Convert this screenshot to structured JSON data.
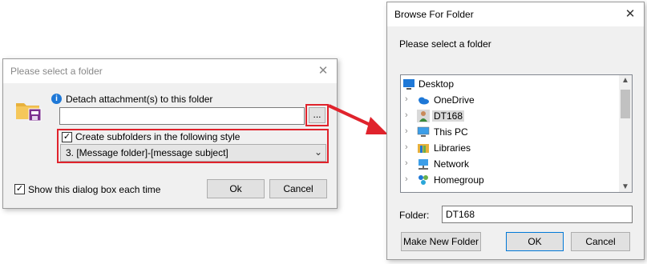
{
  "left_dialog": {
    "title": "Please select a folder",
    "detach_label": "Detach attachment(s) to this folder",
    "path_value": "",
    "browse_label": "...",
    "subfolders_label": "Create subfolders in the following style",
    "subfolders_checked": true,
    "style_selected": "3. [Message folder]-[message subject]",
    "show_dialog_label": "Show this dialog box each time",
    "show_dialog_checked": true,
    "ok_label": "Ok",
    "cancel_label": "Cancel"
  },
  "right_dialog": {
    "title": "Browse For Folder",
    "prompt": "Please select a folder",
    "tree": [
      {
        "label": "Desktop",
        "icon": "desktop-icon"
      },
      {
        "label": "OneDrive",
        "icon": "onedrive-icon"
      },
      {
        "label": "DT168",
        "icon": "user-icon",
        "selected": true
      },
      {
        "label": "This PC",
        "icon": "computer-icon"
      },
      {
        "label": "Libraries",
        "icon": "libraries-icon"
      },
      {
        "label": "Network",
        "icon": "network-icon"
      },
      {
        "label": "Homegroup",
        "icon": "homegroup-icon"
      }
    ],
    "folder_label": "Folder:",
    "folder_value": "DT168",
    "make_new_label": "Make New Folder",
    "ok_label": "OK",
    "cancel_label": "Cancel"
  },
  "colors": {
    "highlight": "#e0232c",
    "selection": "#cce8ff",
    "info": "#1e78d7"
  }
}
